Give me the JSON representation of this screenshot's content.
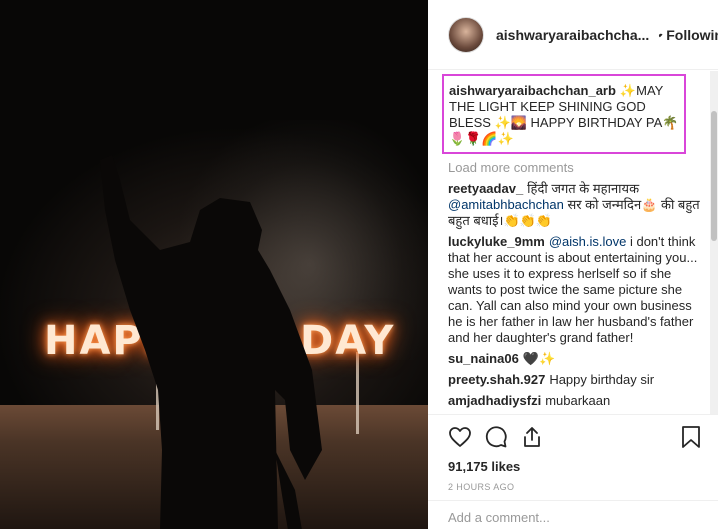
{
  "post": {
    "username": "aishwaryaraibachchan_arb",
    "header_username": "aishwaryaraibachcha...",
    "dot": "•",
    "follow_label": "Following",
    "caption_username": "aishwaryaraibachchan_arb",
    "caption_text": "✨MAY THE LIGHT KEEP SHINING GOD BLESS ✨🌄 HAPPY BIRTHDAY PA🌴🌷🌹🌈✨",
    "photo_sign_left": "HAPPY",
    "photo_sign_right": "DAY"
  },
  "load_more": "Load more comments",
  "comments": [
    {
      "user": "reetyaadav_",
      "pre": "हिंदी जगत के महानायक ",
      "mention": "@amitabhbachchan",
      "post": " सर को जन्मदिन🎂 की बहुत बहुत बधाई।👏👏👏"
    },
    {
      "user": "luckyluke_9mm",
      "pre": "",
      "mention": "@aish.is.love",
      "post": " i don't think that her account is about entertaining you... she uses it to express herlself so if she wants to post twice the same picture she can. Yall can also mind your own business he is her father in law her husband's father and her daughter's grand father!"
    },
    {
      "user": "su_naina06",
      "pre": "🖤✨",
      "mention": "",
      "post": ""
    },
    {
      "user": "preety.shah.927",
      "pre": "Happy birthday sir",
      "mention": "",
      "post": ""
    },
    {
      "user": "amjadhadiysfzi",
      "pre": "mubarkaan",
      "mention": "",
      "post": ""
    }
  ],
  "likes": "91,175 likes",
  "timestamp": "2 HOURS AGO",
  "add_comment_placeholder": "Add a comment...",
  "icons": {
    "like": "heart-icon",
    "comment": "speech-bubble-icon",
    "share": "share-icon",
    "save": "bookmark-icon",
    "verified": "verified-badge-icon"
  },
  "colors": {
    "caption_highlight": "#d946d9",
    "verified": "#3897f0",
    "mention": "#003569",
    "muted": "#999999"
  }
}
